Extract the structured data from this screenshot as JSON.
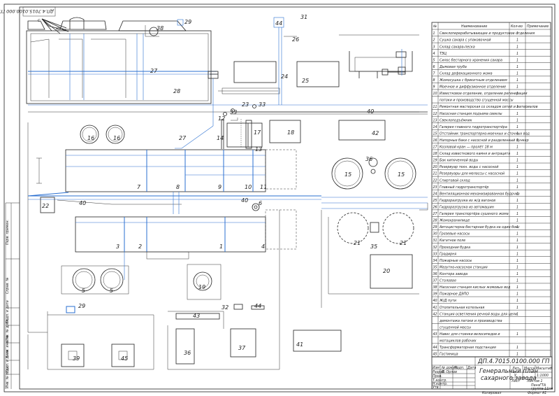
{
  "drawing": {
    "code_main": "ДП.4.7015.0100.000 ГП",
    "code_rotated": "ДП.4.7015.0100.000 ГП",
    "title_line1": "Генеральный план",
    "title_line2": "сахарного завода",
    "scale": "1:1000",
    "format": "Формат А1",
    "copied": "Копировал",
    "org_line1": "ПензГТА",
    "org_line2": "группа 11гм",
    "org_line3": "ДКП",
    "stage_letter": "У"
  },
  "compass": {
    "north": "С",
    "south": "Ю"
  },
  "table": {
    "headers": {
      "num": "№",
      "name": "Наименование",
      "qty": "Кол-во",
      "note": "Примечание"
    },
    "rows": [
      {
        "n": "1",
        "name": "Свеклоперерабатывающее и продуктовое отделения",
        "q": "1"
      },
      {
        "n": "2",
        "name": "Сушка сахара с упаковочной",
        "q": "1"
      },
      {
        "n": "3",
        "name": "Склад сахара-песка",
        "q": "1"
      },
      {
        "n": "4",
        "name": "ТЭЦ",
        "q": "1"
      },
      {
        "n": "5",
        "name": "Силос бестарного хранения сахара",
        "q": "1"
      },
      {
        "n": "6",
        "name": "Дымовая труба",
        "q": "1"
      },
      {
        "n": "7",
        "name": "Склад дефекационного жома",
        "q": "1"
      },
      {
        "n": "8",
        "name": "Жомосушка с брикетным отделением",
        "q": "1"
      },
      {
        "n": "9",
        "name": "Моечное и диффузионное отделение",
        "q": "1"
      },
      {
        "n": "10",
        "name": "Известковое отделение, отделение регенерации",
        "q": "1"
      },
      {
        "n": "",
        "name": "патоки и производство сгущенной массы",
        "q": ""
      },
      {
        "n": "11",
        "name": "Ремонтная мастерская со складом сетей и материалов",
        "q": "1"
      },
      {
        "n": "12",
        "name": "Насосная станция подъема свеклы",
        "q": "1"
      },
      {
        "n": "13",
        "name": "Свеклоподъёмник",
        "q": "1"
      },
      {
        "n": "14",
        "name": "Галерея главного гидротранспортёра",
        "q": "1"
      },
      {
        "n": "15",
        "name": "Отстойник транспортерно-моечных и сточных вод",
        "q": "1"
      },
      {
        "n": "16",
        "name": "Напорные баки с насосной и разделенный бункер",
        "q": "1"
      },
      {
        "n": "17",
        "name": "Козловой кран — пролёт 18 м",
        "q": "1"
      },
      {
        "n": "18",
        "name": "Склад известкового камня и антрацита",
        "q": "1"
      },
      {
        "n": "19",
        "name": "Бак кипяченной воды",
        "q": "1"
      },
      {
        "n": "20",
        "name": "Резервуар техн. воды с насосной",
        "q": "1"
      },
      {
        "n": "21",
        "name": "Резервуары для мелассы с насосной",
        "q": "1"
      },
      {
        "n": "22",
        "name": "Спиртовой склад",
        "q": "1"
      },
      {
        "n": "23",
        "name": "Главный гидротранспортёр",
        "q": "1"
      },
      {
        "n": "24",
        "name": "Вентиляционная механизированная будочка",
        "q": "1"
      },
      {
        "n": "25",
        "name": "Гидроразгрузка из ж/д вагонов",
        "q": "1"
      },
      {
        "n": "26",
        "name": "Гидроразгрузка из автомашин",
        "q": "1"
      },
      {
        "n": "27",
        "name": "Галерея транспортёра сушеного жома",
        "q": "1"
      },
      {
        "n": "28",
        "name": "Жомохранилище",
        "q": "1"
      },
      {
        "n": "29",
        "name": "Автоцистерна бестарная будка на один бокс",
        "q": "1"
      },
      {
        "n": "30",
        "name": "Грязевые насосы",
        "q": "1"
      },
      {
        "n": "31",
        "name": "Кагатное поле",
        "q": "1"
      },
      {
        "n": "32",
        "name": "Проходная будка",
        "q": "1"
      },
      {
        "n": "33",
        "name": "Градирня",
        "q": "1"
      },
      {
        "n": "34",
        "name": "Пожарные насосы",
        "q": "1"
      },
      {
        "n": "35",
        "name": "Мазутно-насосная станция",
        "q": "1"
      },
      {
        "n": "36",
        "name": "Контора завода",
        "q": "1"
      },
      {
        "n": "37",
        "name": "Столовая",
        "q": "1"
      },
      {
        "n": "38",
        "name": "Насосная станция кислых жомовых вод",
        "q": "1"
      },
      {
        "n": "39",
        "name": "Пожарное ДЭПО",
        "q": "1"
      },
      {
        "n": "40",
        "name": "Ж/Д пути",
        "q": "1"
      },
      {
        "n": "41",
        "name": "Отопительная котельная",
        "q": "1"
      },
      {
        "n": "42",
        "name": "Станция осветления речной воды для цели",
        "q": "1"
      },
      {
        "n": "",
        "name": "демонтажа патоки и производства",
        "q": ""
      },
      {
        "n": "",
        "name": "сгущенной массы",
        "q": ""
      },
      {
        "n": "43",
        "name": "Навес для стоянки велосипедов и",
        "q": "1"
      },
      {
        "n": "",
        "name": "мотоциклов рабочих",
        "q": ""
      },
      {
        "n": "44",
        "name": "Трансформаторная подстанция",
        "q": "1"
      },
      {
        "n": "45",
        "name": "Гостиница",
        "q": "1"
      }
    ]
  },
  "stamp": {
    "col_izm": "Изм",
    "col_list": "Лист",
    "col_doc": "№ докум.",
    "col_sign": "Подп.",
    "col_date": "Дата",
    "row_razrab": "Разраб.",
    "row_prov": "Пров.",
    "row_tkontr": "Т.контр.",
    "row_nkontr": "Н.контр.",
    "row_utv": "Утв.",
    "col_lit": "Лит.",
    "col_massa": "Масса",
    "col_masht": "Масштаб",
    "col_sheet": "Лист",
    "col_sheets": "Листов 1",
    "author": "Б. Орлов"
  },
  "side_labels": {
    "perv_primen": "Перв. примен.",
    "sprav": "Справ. №",
    "podp_data1": "Подп. и дата",
    "inv_dubl": "Инв. № дубл.",
    "vzam_inv": "Взам. инв. №",
    "podp_data2": "Подп. и дата",
    "inv_podl": "Инв. № подл."
  },
  "plan_labels": [
    "1",
    "2",
    "3",
    "4",
    "5",
    "5",
    "6",
    "7",
    "8",
    "9",
    "10",
    "11",
    "12",
    "13",
    "14",
    "15",
    "15",
    "16",
    "16",
    "17",
    "18",
    "19",
    "20",
    "21",
    "21",
    "22",
    "23",
    "24",
    "25",
    "26",
    "27",
    "27",
    "28",
    "29",
    "29",
    "31",
    "32",
    "33",
    "33",
    "35",
    "36",
    "36",
    "37",
    "38",
    "39",
    "40",
    "40",
    "40",
    "41",
    "42",
    "43",
    "44",
    "44",
    "45"
  ]
}
